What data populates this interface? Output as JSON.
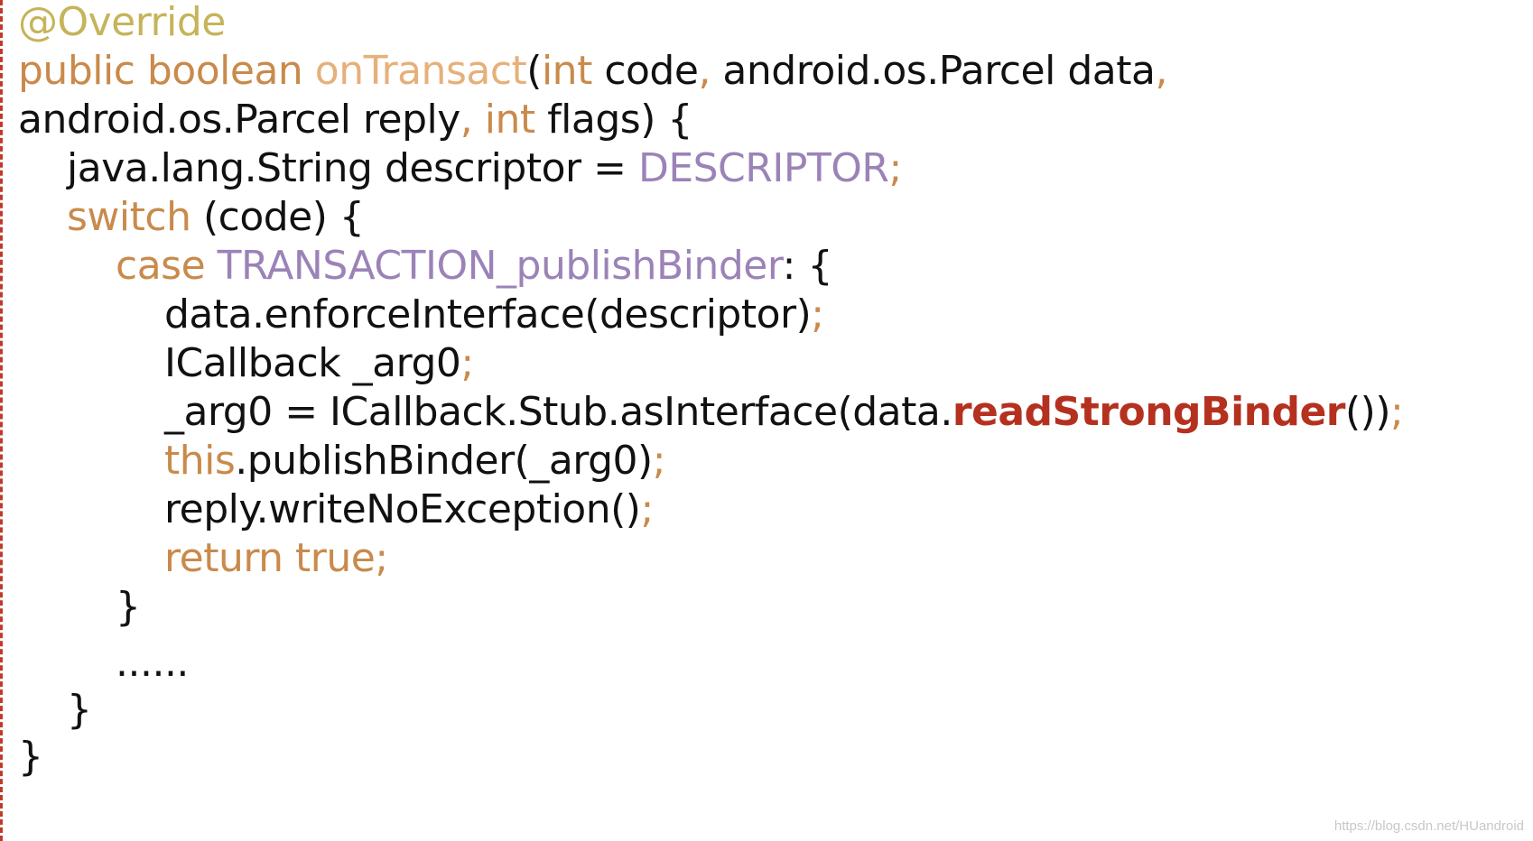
{
  "colors": {
    "keyword": "#c98a4b",
    "method": "#e6b07a",
    "constant": "#9b83b8",
    "annotation": "#c5b45a",
    "highlight": "#b5311f",
    "text": "#111111",
    "border": "#c0392b"
  },
  "lines": [
    {
      "indent": 0,
      "tokens": [
        {
          "t": "@Override",
          "c": "ann"
        }
      ]
    },
    {
      "indent": 0,
      "tokens": [
        {
          "t": "public boolean ",
          "c": "kw"
        },
        {
          "t": "onTransact",
          "c": "fn"
        },
        {
          "t": "(",
          "c": ""
        },
        {
          "t": "int",
          "c": "kw"
        },
        {
          "t": " code",
          "c": ""
        },
        {
          "t": ",",
          "c": "punct"
        },
        {
          "t": " android.os.Parcel data",
          "c": ""
        },
        {
          "t": ",",
          "c": "punct"
        }
      ]
    },
    {
      "indent": 0,
      "tokens": [
        {
          "t": "android.os.Parcel reply",
          "c": ""
        },
        {
          "t": ",",
          "c": "punct"
        },
        {
          "t": " ",
          "c": ""
        },
        {
          "t": "int",
          "c": "kw"
        },
        {
          "t": " flags) {",
          "c": ""
        }
      ]
    },
    {
      "indent": 1,
      "tokens": [
        {
          "t": "java.lang.String descriptor = ",
          "c": ""
        },
        {
          "t": "DESCRIPTOR",
          "c": "const"
        },
        {
          "t": ";",
          "c": "punct"
        }
      ]
    },
    {
      "indent": 1,
      "tokens": [
        {
          "t": "switch",
          "c": "kw"
        },
        {
          "t": " (code) {",
          "c": ""
        }
      ]
    },
    {
      "indent": 2,
      "tokens": [
        {
          "t": "case ",
          "c": "kw"
        },
        {
          "t": "TRANSACTION_publishBinder",
          "c": "const"
        },
        {
          "t": ": {",
          "c": ""
        }
      ]
    },
    {
      "indent": 3,
      "tokens": [
        {
          "t": "data.enforceInterface(descriptor)",
          "c": ""
        },
        {
          "t": ";",
          "c": "punct"
        }
      ]
    },
    {
      "indent": 3,
      "tokens": [
        {
          "t": "ICallback _arg0",
          "c": ""
        },
        {
          "t": ";",
          "c": "punct"
        }
      ]
    },
    {
      "indent": 3,
      "tokens": [
        {
          "t": "_arg0 = ICallback.Stub.asInterface(data.",
          "c": ""
        },
        {
          "t": "readStrongBinder",
          "c": "hl"
        },
        {
          "t": "())",
          "c": ""
        },
        {
          "t": ";",
          "c": "punct"
        }
      ]
    },
    {
      "indent": 3,
      "tokens": [
        {
          "t": "this",
          "c": "kw"
        },
        {
          "t": ".publishBinder(_arg0)",
          "c": ""
        },
        {
          "t": ";",
          "c": "punct"
        }
      ]
    },
    {
      "indent": 3,
      "tokens": [
        {
          "t": "reply.writeNoException()",
          "c": ""
        },
        {
          "t": ";",
          "c": "punct"
        }
      ]
    },
    {
      "indent": 3,
      "tokens": [
        {
          "t": "return true;",
          "c": "kw"
        }
      ]
    },
    {
      "indent": 2,
      "tokens": [
        {
          "t": "}",
          "c": ""
        }
      ]
    },
    {
      "indent": 2,
      "tokens": [
        {
          "t": "......",
          "c": ""
        }
      ]
    },
    {
      "indent": 1,
      "tokens": [
        {
          "t": "}",
          "c": ""
        }
      ]
    },
    {
      "indent": 0,
      "tokens": [
        {
          "t": "}",
          "c": ""
        }
      ]
    }
  ],
  "watermark": "https://blog.csdn.net/HUandroid"
}
